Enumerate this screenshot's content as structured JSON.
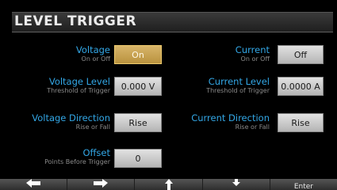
{
  "title": "LEVEL TRIGGER",
  "fields": {
    "voltage": {
      "label": "Voltage",
      "sub": "On or Off",
      "value": "On"
    },
    "current": {
      "label": "Current",
      "sub": "On or Off",
      "value": "Off"
    },
    "voltage_level": {
      "label": "Voltage Level",
      "sub": "Threshold of Trigger",
      "value": "0.000 V"
    },
    "current_level": {
      "label": "Current Level",
      "sub": "Threshold of Trigger",
      "value": "0.0000 A"
    },
    "voltage_direction": {
      "label": "Voltage Direction",
      "sub": "Rise or Fall",
      "value": "Rise"
    },
    "current_direction": {
      "label": "Current Direction",
      "sub": "Rise or Fall",
      "value": "Rise"
    },
    "offset": {
      "label": "Offset",
      "sub": "Points Before Trigger",
      "value": "0"
    }
  },
  "softkeys": {
    "left": {
      "icon": "arrow-left-icon"
    },
    "right": {
      "icon": "arrow-right-icon"
    },
    "up": {
      "icon": "arrow-up-icon"
    },
    "down": {
      "icon": "arrow-down-icon"
    },
    "enter": {
      "label": "Enter"
    }
  },
  "colors": {
    "accent_blue": "#33a7e6",
    "active_button": "#c9a452",
    "button": "#cccccc",
    "background": "#000000"
  }
}
